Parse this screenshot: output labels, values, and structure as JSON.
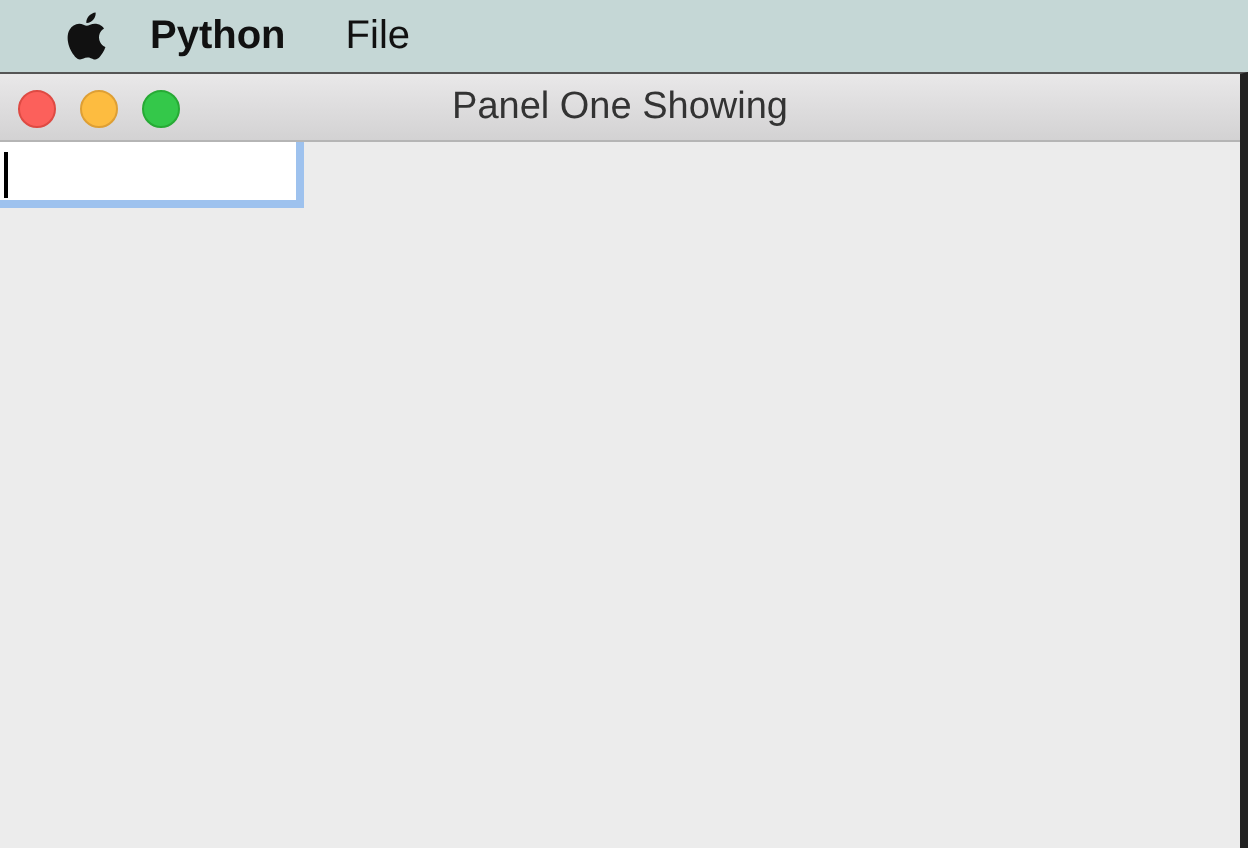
{
  "menu_bar": {
    "items": [
      {
        "kind": "app",
        "label": "Python"
      },
      {
        "kind": "menu",
        "label": "File"
      }
    ]
  },
  "window": {
    "title": "Panel One Showing",
    "text_field": {
      "focused": true
    }
  }
}
